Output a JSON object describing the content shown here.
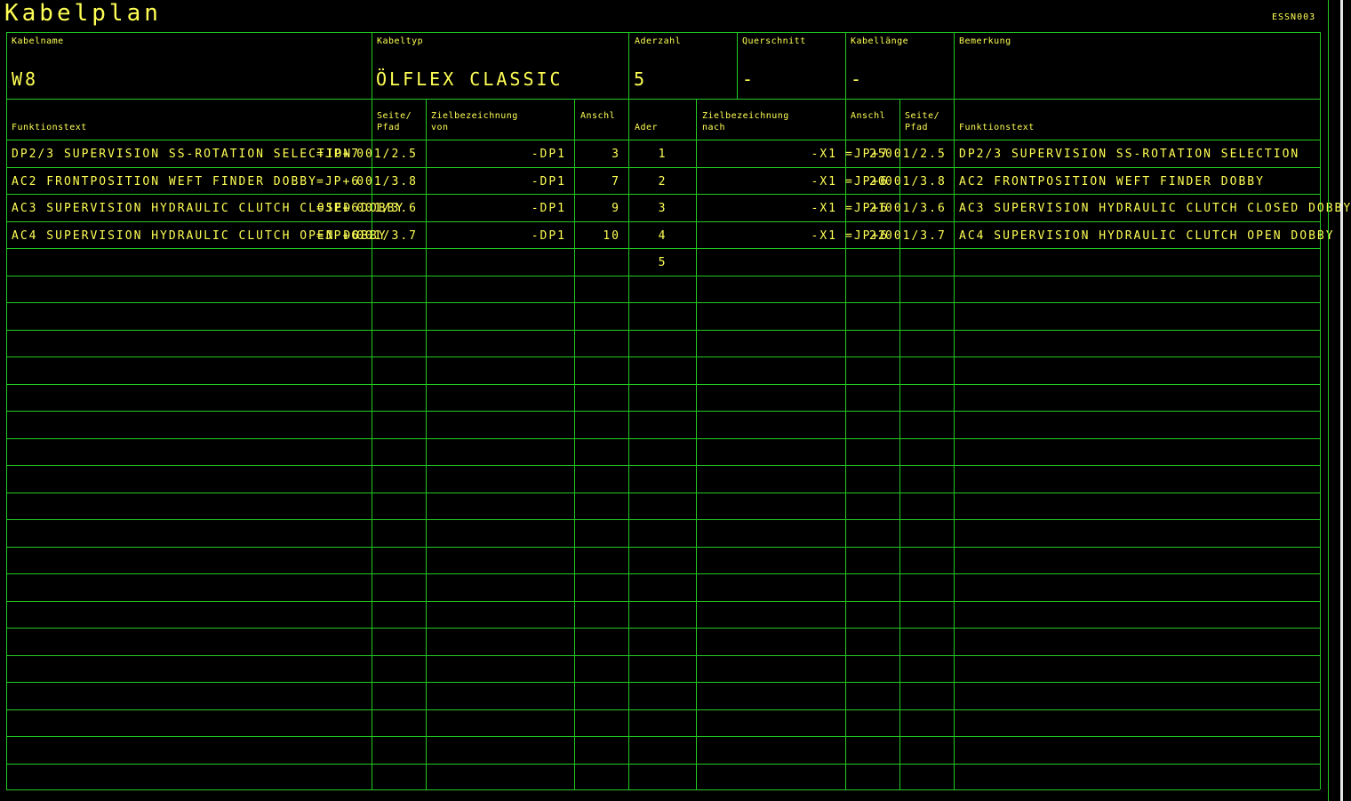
{
  "title": "Kabelplan",
  "doc_code": "ESSN003",
  "header": {
    "kabelname_label": "Kabelname",
    "kabelname": "W8",
    "kabeltyp_label": "Kabeltyp",
    "kabeltyp": "ÖLFLEX CLASSIC",
    "aderzahl_label": "Aderzahl",
    "aderzahl": "5",
    "querschnitt_label": "Querschnitt",
    "querschnitt": "-",
    "kabellaenge_label": "Kabellänge",
    "kabellaenge": "-",
    "bemerkung_label": "Bemerkung"
  },
  "columns": {
    "funktionstext": "Funktionstext",
    "seite_pfad": "Seite/\nPfad",
    "ziel_von": "Zielbezeichnung\nvon",
    "anschl": "Anschl",
    "ader": "Ader",
    "ziel_nach": "Zielbezeichnung\nnach",
    "anschl2": "Anschl",
    "seite_pfad2": "Seite/\nPfad",
    "funktionstext2": "Funktionstext"
  },
  "rows": [
    {
      "func": "DP2/3 SUPERVISION SS-ROTATION SELECTION",
      "loc": "=JP+7",
      "page": "001/2.5",
      "ziel_von": "-DP1",
      "anschl": "3",
      "ader": "1",
      "ziel_nach": "-X1",
      "anschl2": "=JP+7",
      "anschl2_b": "25",
      "page2": "001/2.5",
      "func2": "DP2/3 SUPERVISION SS-ROTATION SELECTION"
    },
    {
      "func": "AC2 FRONTPOSITION WEFT FINDER DOBBY",
      "loc": "=JP+6",
      "page": "001/3.8",
      "ziel_von": "-DP1",
      "anschl": "7",
      "ader": "2",
      "ziel_nach": "-X1",
      "anschl2": "=JP+6",
      "anschl2_b": "20",
      "page2": "001/3.8",
      "func2": "AC2 FRONTPOSITION WEFT FINDER DOBBY"
    },
    {
      "func": "AC3 SUPERVISION HYDRAULIC CLUTCH CLOSED DOBBY",
      "loc": "=JP+6",
      "page": "001/3.6",
      "ziel_von": "-DP1",
      "anschl": "9",
      "ader": "3",
      "ziel_nach": "-X1",
      "anschl2": "=JP+6",
      "anschl2_b": "21",
      "page2": "001/3.6",
      "func2": "AC3 SUPERVISION HYDRAULIC CLUTCH CLOSED DOBBY"
    },
    {
      "func": "AC4 SUPERVISION HYDRAULIC CLUTCH OPEN DOBBY",
      "loc": "=JP+6",
      "page": "001/3.7",
      "ziel_von": "-DP1",
      "anschl": "10",
      "ader": "4",
      "ziel_nach": "-X1",
      "anschl2": "=JP+6",
      "anschl2_b": "22",
      "page2": "001/3.7",
      "func2": "AC4 SUPERVISION HYDRAULIC CLUTCH OPEN DOBBY"
    },
    {
      "func": "",
      "loc": "",
      "page": "",
      "ziel_von": "",
      "anschl": "",
      "ader": "5",
      "ziel_nach": "",
      "anschl2": "",
      "anschl2_b": "",
      "page2": "",
      "func2": ""
    }
  ]
}
